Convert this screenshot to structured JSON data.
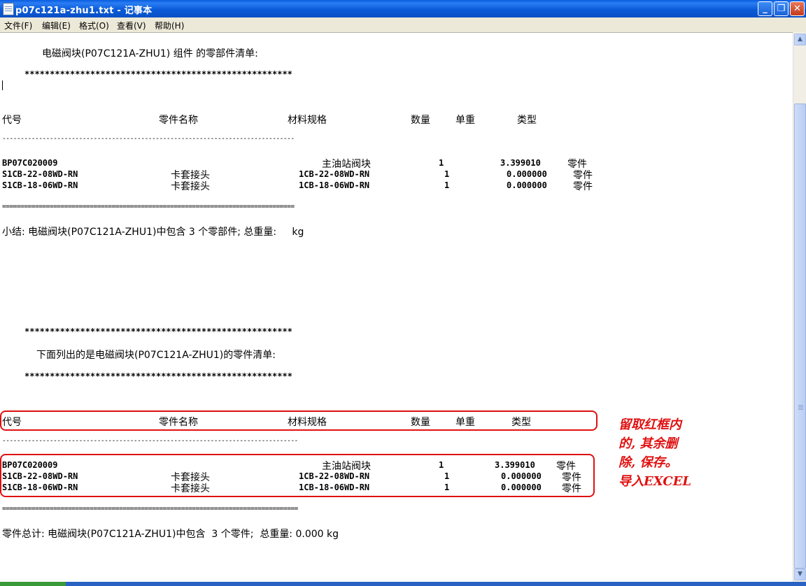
{
  "window": {
    "title": "p07c121a-zhu1.txt - 记事本",
    "minimize_icon": "minimize-icon",
    "maximize_icon": "restore-icon",
    "close_icon": "close-icon"
  },
  "menu": [
    "文件(F)",
    "编辑(E)",
    "格式(O)",
    "查看(V)",
    "帮助(H)"
  ],
  "document": {
    "section1": {
      "heading": "电磁阀块(P07C121A-ZHU1) 组件 的零部件清单:",
      "stars": "*****************************************************",
      "headers": {
        "code": "代号",
        "name": "零件名称",
        "spec": "材料规格",
        "qty": "数量",
        "weight": "单重",
        "type": "类型"
      },
      "dash_line": "--------------------------------------------------------------------------------",
      "rows": [
        {
          "code": "BP07C020009",
          "name": "",
          "spec": "主油站阀块",
          "qty": "1",
          "weight": "3.399010",
          "type": "零件"
        },
        {
          "code": "S1CB-22-08WD-RN",
          "name": "卡套接头",
          "spec": "1CB-22-08WD-RN",
          "qty": "1",
          "weight": "0.000000",
          "type": "零件"
        },
        {
          "code": "S1CB-18-06WD-RN",
          "name": "卡套接头",
          "spec": "1CB-18-06WD-RN",
          "qty": "1",
          "weight": "0.000000",
          "type": "零件"
        }
      ],
      "eq_line": "================================================================================",
      "summary": "小结: 电磁阀块(P07C121A-ZHU1)中包含 3 个零部件; 总重量:     kg"
    },
    "section2": {
      "stars_top": "*****************************************************",
      "heading": "下面列出的是电磁阀块(P07C121A-ZHU1)的零件清单:",
      "stars_bottom": "*****************************************************",
      "headers": {
        "code": "代号",
        "name": "零件名称",
        "spec": "材料规格",
        "qty": "数量",
        "weight": "单重",
        "type": "类型"
      },
      "dash_line": "---------------------------------------------------------------------------------",
      "rows": [
        {
          "code": "BP07C020009",
          "name": "",
          "spec": "主油站阀块",
          "qty": "1",
          "weight": "3.399010",
          "type": "零件"
        },
        {
          "code": "S1CB-22-08WD-RN",
          "name": "卡套接头",
          "spec": "1CB-22-08WD-RN",
          "qty": "1",
          "weight": "0.000000",
          "type": "零件"
        },
        {
          "code": "S1CB-18-06WD-RN",
          "name": "卡套接头",
          "spec": "1CB-18-06WD-RN",
          "qty": "1",
          "weight": "0.000000",
          "type": "零件"
        }
      ],
      "eq_line": "=================================================================================",
      "total": "零件总计: 电磁阀块(P07C121A-ZHU1)中包含  3 个零件;  总重量: 0.000 kg"
    }
  },
  "annotation": {
    "lines": [
      "留取红框内",
      "的, 其余删",
      "除, 保存。",
      "导入EXCEL"
    ],
    "color": "#e01010"
  }
}
